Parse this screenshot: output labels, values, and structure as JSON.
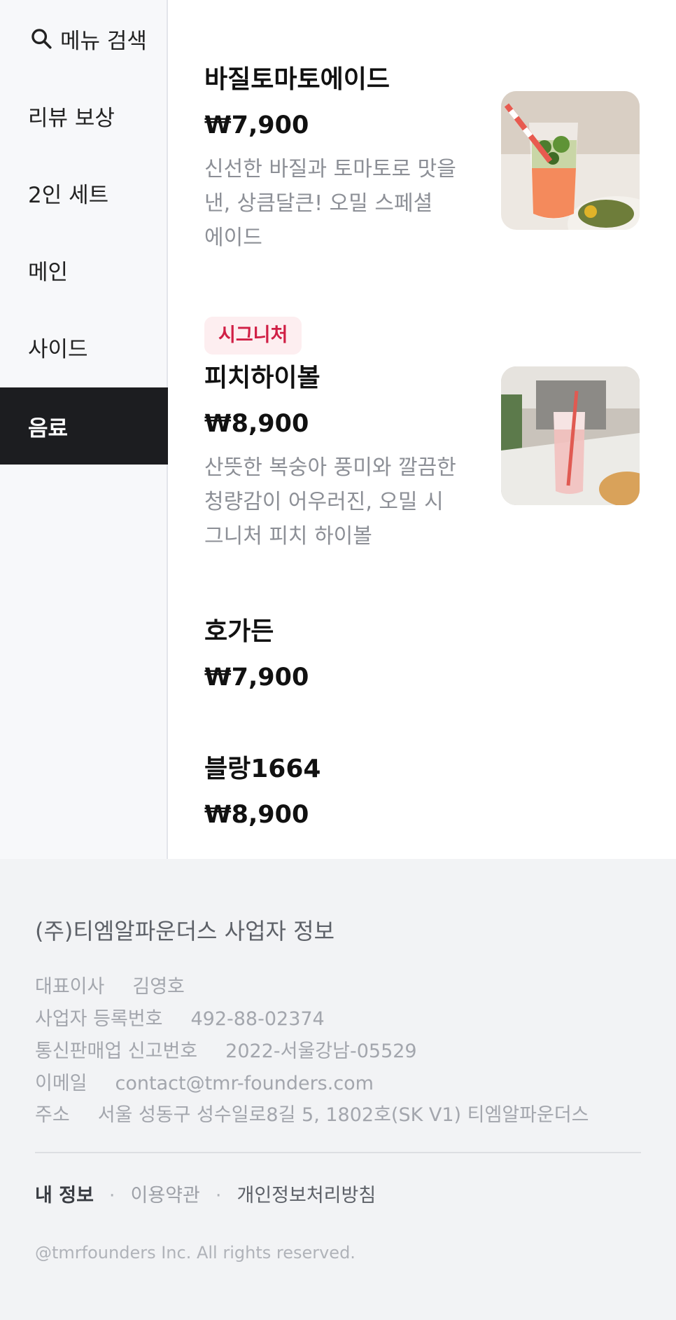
{
  "sidebar": {
    "search_label": "메뉴 검색",
    "items": [
      {
        "label": "리뷰 보상"
      },
      {
        "label": "2인 세트"
      },
      {
        "label": "메인"
      },
      {
        "label": "사이드"
      },
      {
        "label": "음료"
      }
    ],
    "active_index": 4
  },
  "menu": {
    "items": [
      {
        "name": "바질토마토에이드",
        "price": "₩7,900",
        "description": "신선한 바질과 토마토로 맛을 낸, 상큼달큰! 오밀 스페셜 에이드"
      },
      {
        "badge": "시그니처",
        "name": "피치하이볼",
        "price": "₩8,900",
        "description": "산뜻한 복숭아 풍미와 깔끔한 청량감이 어우러진, 오밀 시그니처 피치 하이볼"
      },
      {
        "name": "호가든",
        "price": "₩7,900"
      },
      {
        "name": "블랑1664",
        "price": "₩8,900"
      }
    ]
  },
  "footer": {
    "title": "(주)티엠알파운더스 사업자 정보",
    "info": [
      {
        "key": "대표이사",
        "value": "김영호"
      },
      {
        "key": "사업자 등록번호",
        "value": "492-88-02374"
      },
      {
        "key": "통신판매업 신고번호",
        "value": "2022-서울강남-05529"
      },
      {
        "key": "이메일",
        "value": "contact@tmr-founders.com"
      },
      {
        "key": "주소",
        "value": "서울 성동구 성수일로8길 5, 1802호(SK V1) 티엠알파운더스"
      }
    ],
    "links": {
      "my_info": "내 정보",
      "terms": "이용약관",
      "privacy": "개인정보처리방침",
      "separator": "·"
    },
    "copyright": "@tmrfounders Inc. All rights reserved."
  },
  "colors": {
    "active_bg": "#1c1d20",
    "badge_bg": "#fdeef0",
    "badge_text": "#d01f45",
    "footer_bg": "#f2f3f5"
  }
}
